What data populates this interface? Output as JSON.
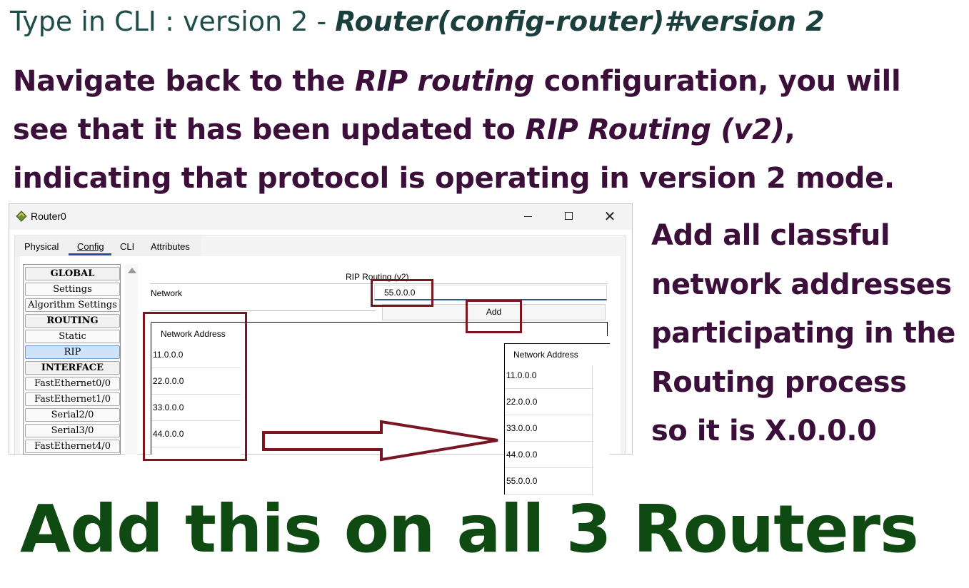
{
  "instructions": {
    "line1_prefix": "Type in CLI : version 2 - ",
    "line1_command": "Router(config-router)#version 2",
    "nav_part1": "Navigate back to the ",
    "nav_italic1": "RIP routing",
    "nav_part2": " configuration, you will see that it has been updated to ",
    "nav_italic2": "RIP Routing (v2)",
    "nav_part3": ", indicating that protocol is operating in version 2 mode.",
    "side_lines": [
      "Add all classful",
      "network addresses",
      "participating in the",
      "Routing process",
      "so it is X.0.0.0"
    ],
    "big_footer": "Add this on all 3 Routers"
  },
  "window": {
    "title": "Router0",
    "tabs": [
      "Physical",
      "Config",
      "CLI",
      "Attributes"
    ],
    "active_tab": "Config"
  },
  "sidebar": {
    "items": [
      {
        "label": "GLOBAL",
        "type": "header"
      },
      {
        "label": "Settings",
        "type": "item"
      },
      {
        "label": "Algorithm Settings",
        "type": "item"
      },
      {
        "label": "ROUTING",
        "type": "header"
      },
      {
        "label": "Static",
        "type": "item"
      },
      {
        "label": "RIP",
        "type": "item",
        "selected": true
      },
      {
        "label": "INTERFACE",
        "type": "header"
      },
      {
        "label": "FastEthernet0/0",
        "type": "item"
      },
      {
        "label": "FastEthernet1/0",
        "type": "item"
      },
      {
        "label": "Serial2/0",
        "type": "item"
      },
      {
        "label": "Serial3/0",
        "type": "item"
      },
      {
        "label": "FastEthernet4/0",
        "type": "item"
      }
    ]
  },
  "rip_config": {
    "section_title": "RIP Routing (v2)",
    "network_label": "Network",
    "network_value": "55.0.0.0",
    "add_button": "Add",
    "table_header": "Network Address",
    "networks_before": [
      "11.0.0.0",
      "22.0.0.0",
      "33.0.0.0",
      "44.0.0.0"
    ],
    "networks_after": [
      "11.0.0.0",
      "22.0.0.0",
      "33.0.0.0",
      "44.0.0.0",
      "55.0.0.0"
    ]
  },
  "colors": {
    "heading_teal": "#1e4d4a",
    "instruction_purple": "#3b0f3a",
    "footer_green": "#0f4a12",
    "annotation_maroon": "#7a1622"
  }
}
